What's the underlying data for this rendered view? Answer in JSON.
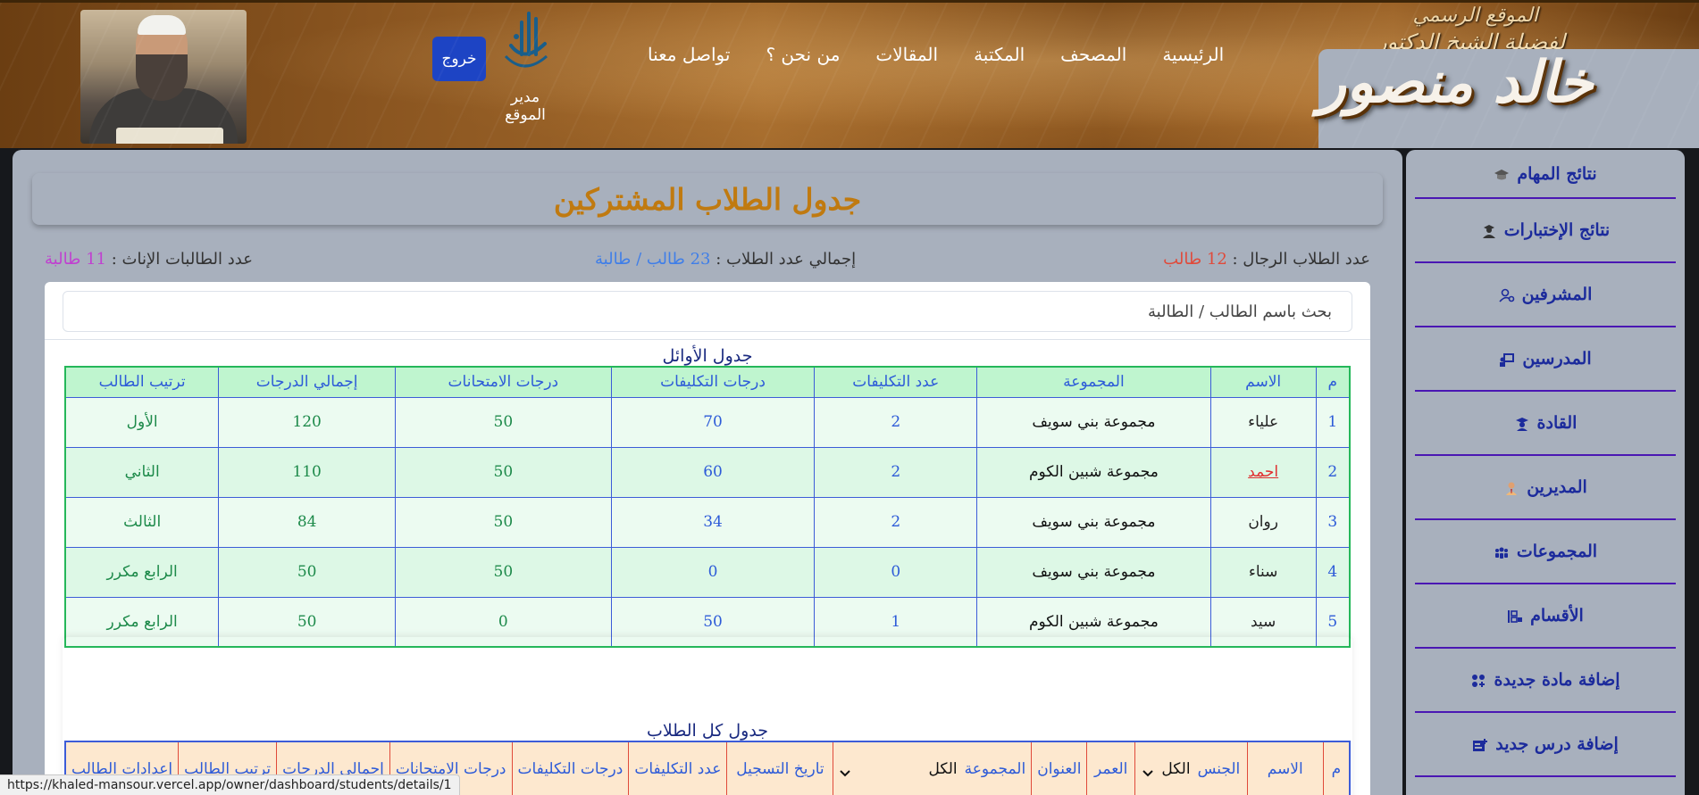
{
  "header": {
    "brand_line1": "الموقع الرسمي",
    "brand_line2": "لفضيلة الشيخ الدكتور",
    "brand_name": "خالد منصور",
    "nav": [
      {
        "label": "الرئيسية"
      },
      {
        "label": "المصحف"
      },
      {
        "label": "المكتبة"
      },
      {
        "label": "المقالات"
      },
      {
        "label": "من نحن ؟"
      },
      {
        "label": "تواصل معنا"
      }
    ],
    "logout_label": "خروج",
    "admin_caption": "مدير الموقع"
  },
  "sidebar": {
    "items": [
      {
        "label": "نتائج المهام",
        "icon": "graduation-cap-icon"
      },
      {
        "label": "نتائج الإختبارات",
        "icon": "user-graduate-icon"
      },
      {
        "label": "المشرفين",
        "icon": "user-gear-icon"
      },
      {
        "label": "المدرسين",
        "icon": "chalkboard-teacher-icon"
      },
      {
        "label": "القادة",
        "icon": "user-shield-icon"
      },
      {
        "label": "المديرين",
        "icon": "user-tie-icon"
      },
      {
        "label": "المجموعات",
        "icon": "people-group-icon"
      },
      {
        "label": "الأقسام",
        "icon": "sections-icon"
      },
      {
        "label": "إضافة مادة جديدة",
        "icon": "add-subject-icon"
      },
      {
        "label": "إضافة درس جديد",
        "icon": "add-lesson-icon"
      }
    ]
  },
  "main": {
    "title": "جدول الطلاب المشتركين",
    "stats": {
      "male_label": "عدد الطلاب الرجال :",
      "male_value": "12 طالب",
      "total_label": "إجمالي عدد الطلاب :",
      "total_value": "23 طالب / طالبة",
      "female_label": "عدد الطالبات الإناث :",
      "female_value": "11 طالبة"
    },
    "search_placeholder": "بحث باسم الطالب / الطالبة",
    "top_table": {
      "caption": "جدول الأوائل",
      "headers": [
        "م",
        "الاسم",
        "المجموعة",
        "عدد التكليفات",
        "درجات التكليفات",
        "درجات الامتحانات",
        "إجمالي الدرجات",
        "ترتيب الطالب"
      ],
      "rows": [
        {
          "num": "1",
          "name": "علياء",
          "group": "مجموعة بني سويف",
          "tasks": "2",
          "task_grades": "70",
          "exam_grades": "50",
          "total": "120",
          "rank": "الأول",
          "link": false
        },
        {
          "num": "2",
          "name": "احمد",
          "group": "مجموعة شبين الكوم",
          "tasks": "2",
          "task_grades": "60",
          "exam_grades": "50",
          "total": "110",
          "rank": "الثاني",
          "link": true
        },
        {
          "num": "3",
          "name": "روان",
          "group": "مجموعة بني سويف",
          "tasks": "2",
          "task_grades": "34",
          "exam_grades": "50",
          "total": "84",
          "rank": "الثالث",
          "link": false
        },
        {
          "num": "4",
          "name": "سناء",
          "group": "مجموعة بني سويف",
          "tasks": "0",
          "task_grades": "0",
          "exam_grades": "50",
          "total": "50",
          "rank": "الرابع مكرر",
          "link": false
        },
        {
          "num": "5",
          "name": "سيد",
          "group": "مجموعة شبين الكوم",
          "tasks": "1",
          "task_grades": "50",
          "exam_grades": "0",
          "total": "50",
          "rank": "الرابع مكرر",
          "link": false
        }
      ]
    },
    "all_table": {
      "caption": "جدول كل الطلاب",
      "h_num": "م",
      "h_name": "الاسم",
      "h_gender": "الجنس",
      "gender_value": "الكل",
      "h_age": "العمر",
      "h_address": "العنوان",
      "h_group": "المجموعة",
      "group_value": "الكل",
      "h_reg_date": "تاريخ التسجيل",
      "h_tasks": "عدد التكليفات",
      "h_task_grades": "درجات التكليفات",
      "h_exam_grades": "درجات الامتحانات",
      "h_total": "إجمالي الدرجات",
      "h_rank": "ترتيب الطالب",
      "h_extra": "إعدادات الطالب"
    }
  },
  "statusbar": {
    "url": "https://khaled-mansour.vercel.app/owner/dashboard/students/details/1"
  },
  "colors": {
    "title": "#c07a10",
    "male": "#e04a3a",
    "total": "#3f7ee8",
    "female": "#c040d0",
    "logout": "#1d44c4",
    "sidebar_text": "#1c2b9c"
  }
}
